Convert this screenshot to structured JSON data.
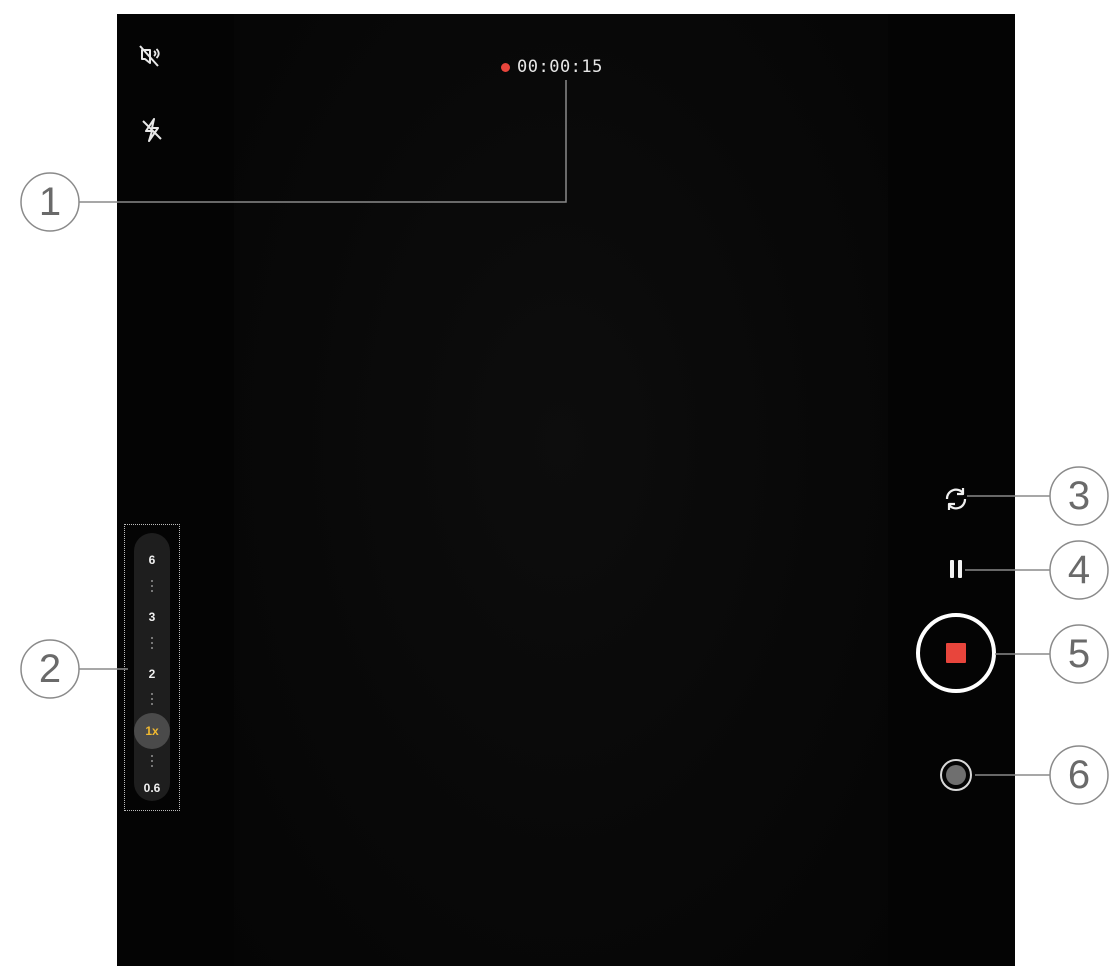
{
  "recording": {
    "time": "00:00:15",
    "dot_color": "#e8453c"
  },
  "top_icons": [
    {
      "name": "mute-microphone-icon"
    },
    {
      "name": "flash-off-icon"
    }
  ],
  "zoom": {
    "levels": [
      "6",
      "3",
      "2",
      "1x",
      "0.6"
    ],
    "selected": "1x",
    "selected_color": "#f1b930"
  },
  "controls": {
    "switch_camera_icon": "camera-switch-icon",
    "pause_icon": "pause-icon",
    "stop_icon": "stop-icon",
    "stop_color": "#e8453c",
    "snapshot_icon": "snapshot-icon"
  },
  "callouts": [
    "1",
    "2",
    "3",
    "4",
    "5",
    "6"
  ]
}
